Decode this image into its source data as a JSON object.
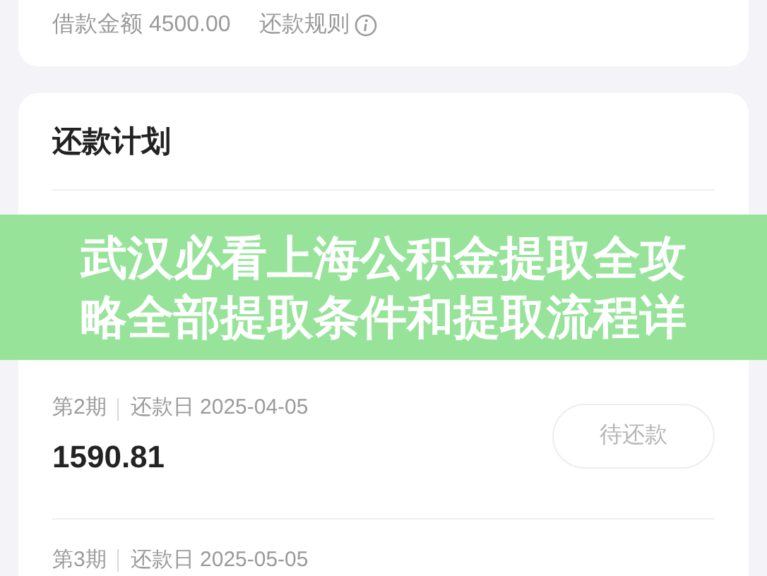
{
  "loan_card": {
    "loan_amount": "借款金额 4500.00",
    "rules_link": "还款规则"
  },
  "plan": {
    "title": "还款计划",
    "installments": [
      {
        "period": "第2期",
        "due_date": "还款日 2025-04-05",
        "amount": "1590.81",
        "status": "待还款"
      },
      {
        "period": "第3期",
        "due_date": "还款日 2025-05-05"
      }
    ]
  },
  "banner": {
    "lines": [
      "武汉必看上海公积金提取全攻",
      "略全部提取条件和提取流程详"
    ]
  }
}
